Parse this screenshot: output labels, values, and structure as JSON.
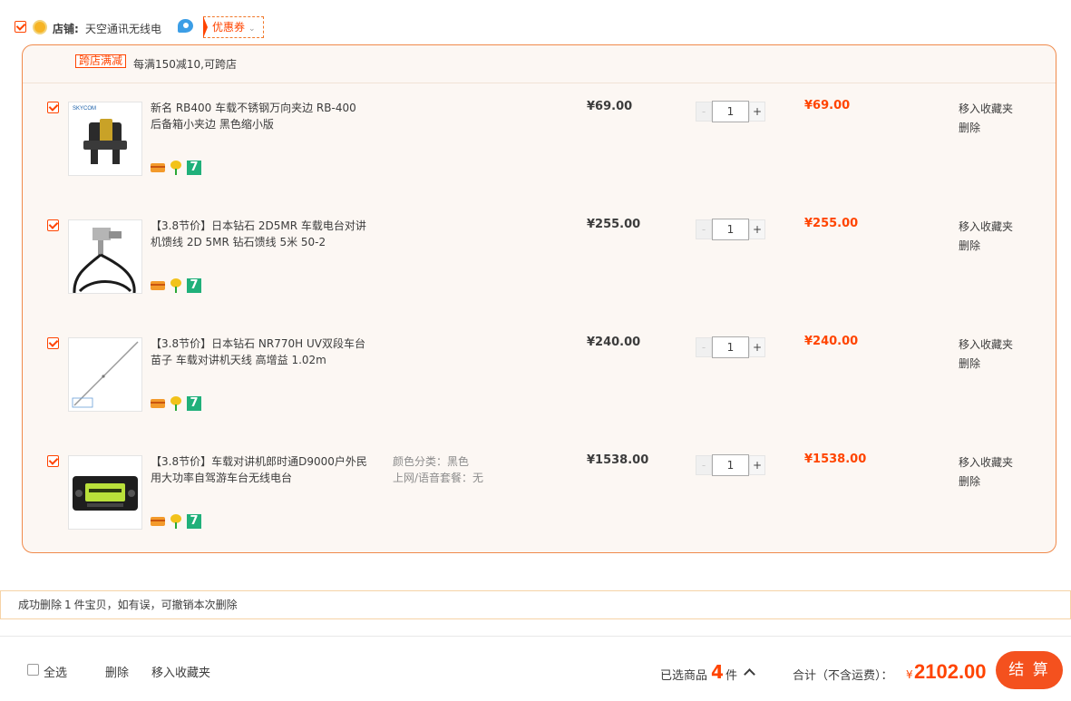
{
  "shop": {
    "label": "店铺:",
    "name": "天空通讯无线电",
    "coupon_label": "优惠券",
    "coupon_chevron": "⌄"
  },
  "promo": {
    "tag": "跨店满减",
    "text": "每满150减10,可跨店"
  },
  "items": [
    {
      "title": "新名 RB400 车载不锈钢万向夹边 RB-400 后备箱小夹边 黑色缩小版",
      "props": "",
      "price": "¥69.00",
      "qty": "1",
      "subtotal": "¥69.00",
      "fav_label": "移入收藏夹",
      "delete_label": "删除"
    },
    {
      "title": "【3.8节价】日本钻石 2D5MR 车载电台对讲机馈线 2D 5MR 钻石馈线 5米 50-2",
      "props": "",
      "price": "¥255.00",
      "qty": "1",
      "subtotal": "¥255.00",
      "fav_label": "移入收藏夹",
      "delete_label": "删除"
    },
    {
      "title": "【3.8节价】日本钻石 NR770H UV双段车台苗子 车载对讲机天线 高增益 1.02m",
      "props": "",
      "price": "¥240.00",
      "qty": "1",
      "subtotal": "¥240.00",
      "fav_label": "移入收藏夹",
      "delete_label": "删除"
    },
    {
      "title": "【3.8节价】车载对讲机郎时通D9000户外民用大功率自驾游车台无线电台",
      "props": "颜色分类：黑色\n上网/语音套餐：无",
      "price": "¥1538.00",
      "qty": "1",
      "subtotal": "¥1538.00",
      "fav_label": "移入收藏夹",
      "delete_label": "删除"
    }
  ],
  "qty_controls": {
    "minus": "-",
    "plus": "+"
  },
  "undo": {
    "prefix": "成功删除",
    "count": "1",
    "suffix": "件宝贝，如有误，可撤销本次删除"
  },
  "footer": {
    "select_all": "全选",
    "delete": "删除",
    "move_to_favorites": "移入收藏夹",
    "selected_label": "已选商品",
    "selected_count": "4",
    "selected_unit": "件",
    "total_label": "合计（不含运费）：",
    "currency": "¥",
    "total": "2102.00",
    "checkout": "结 算"
  },
  "colors": {
    "accent": "#ff4400",
    "border": "#f08a4b",
    "box_bg": "#fcf7f3"
  }
}
